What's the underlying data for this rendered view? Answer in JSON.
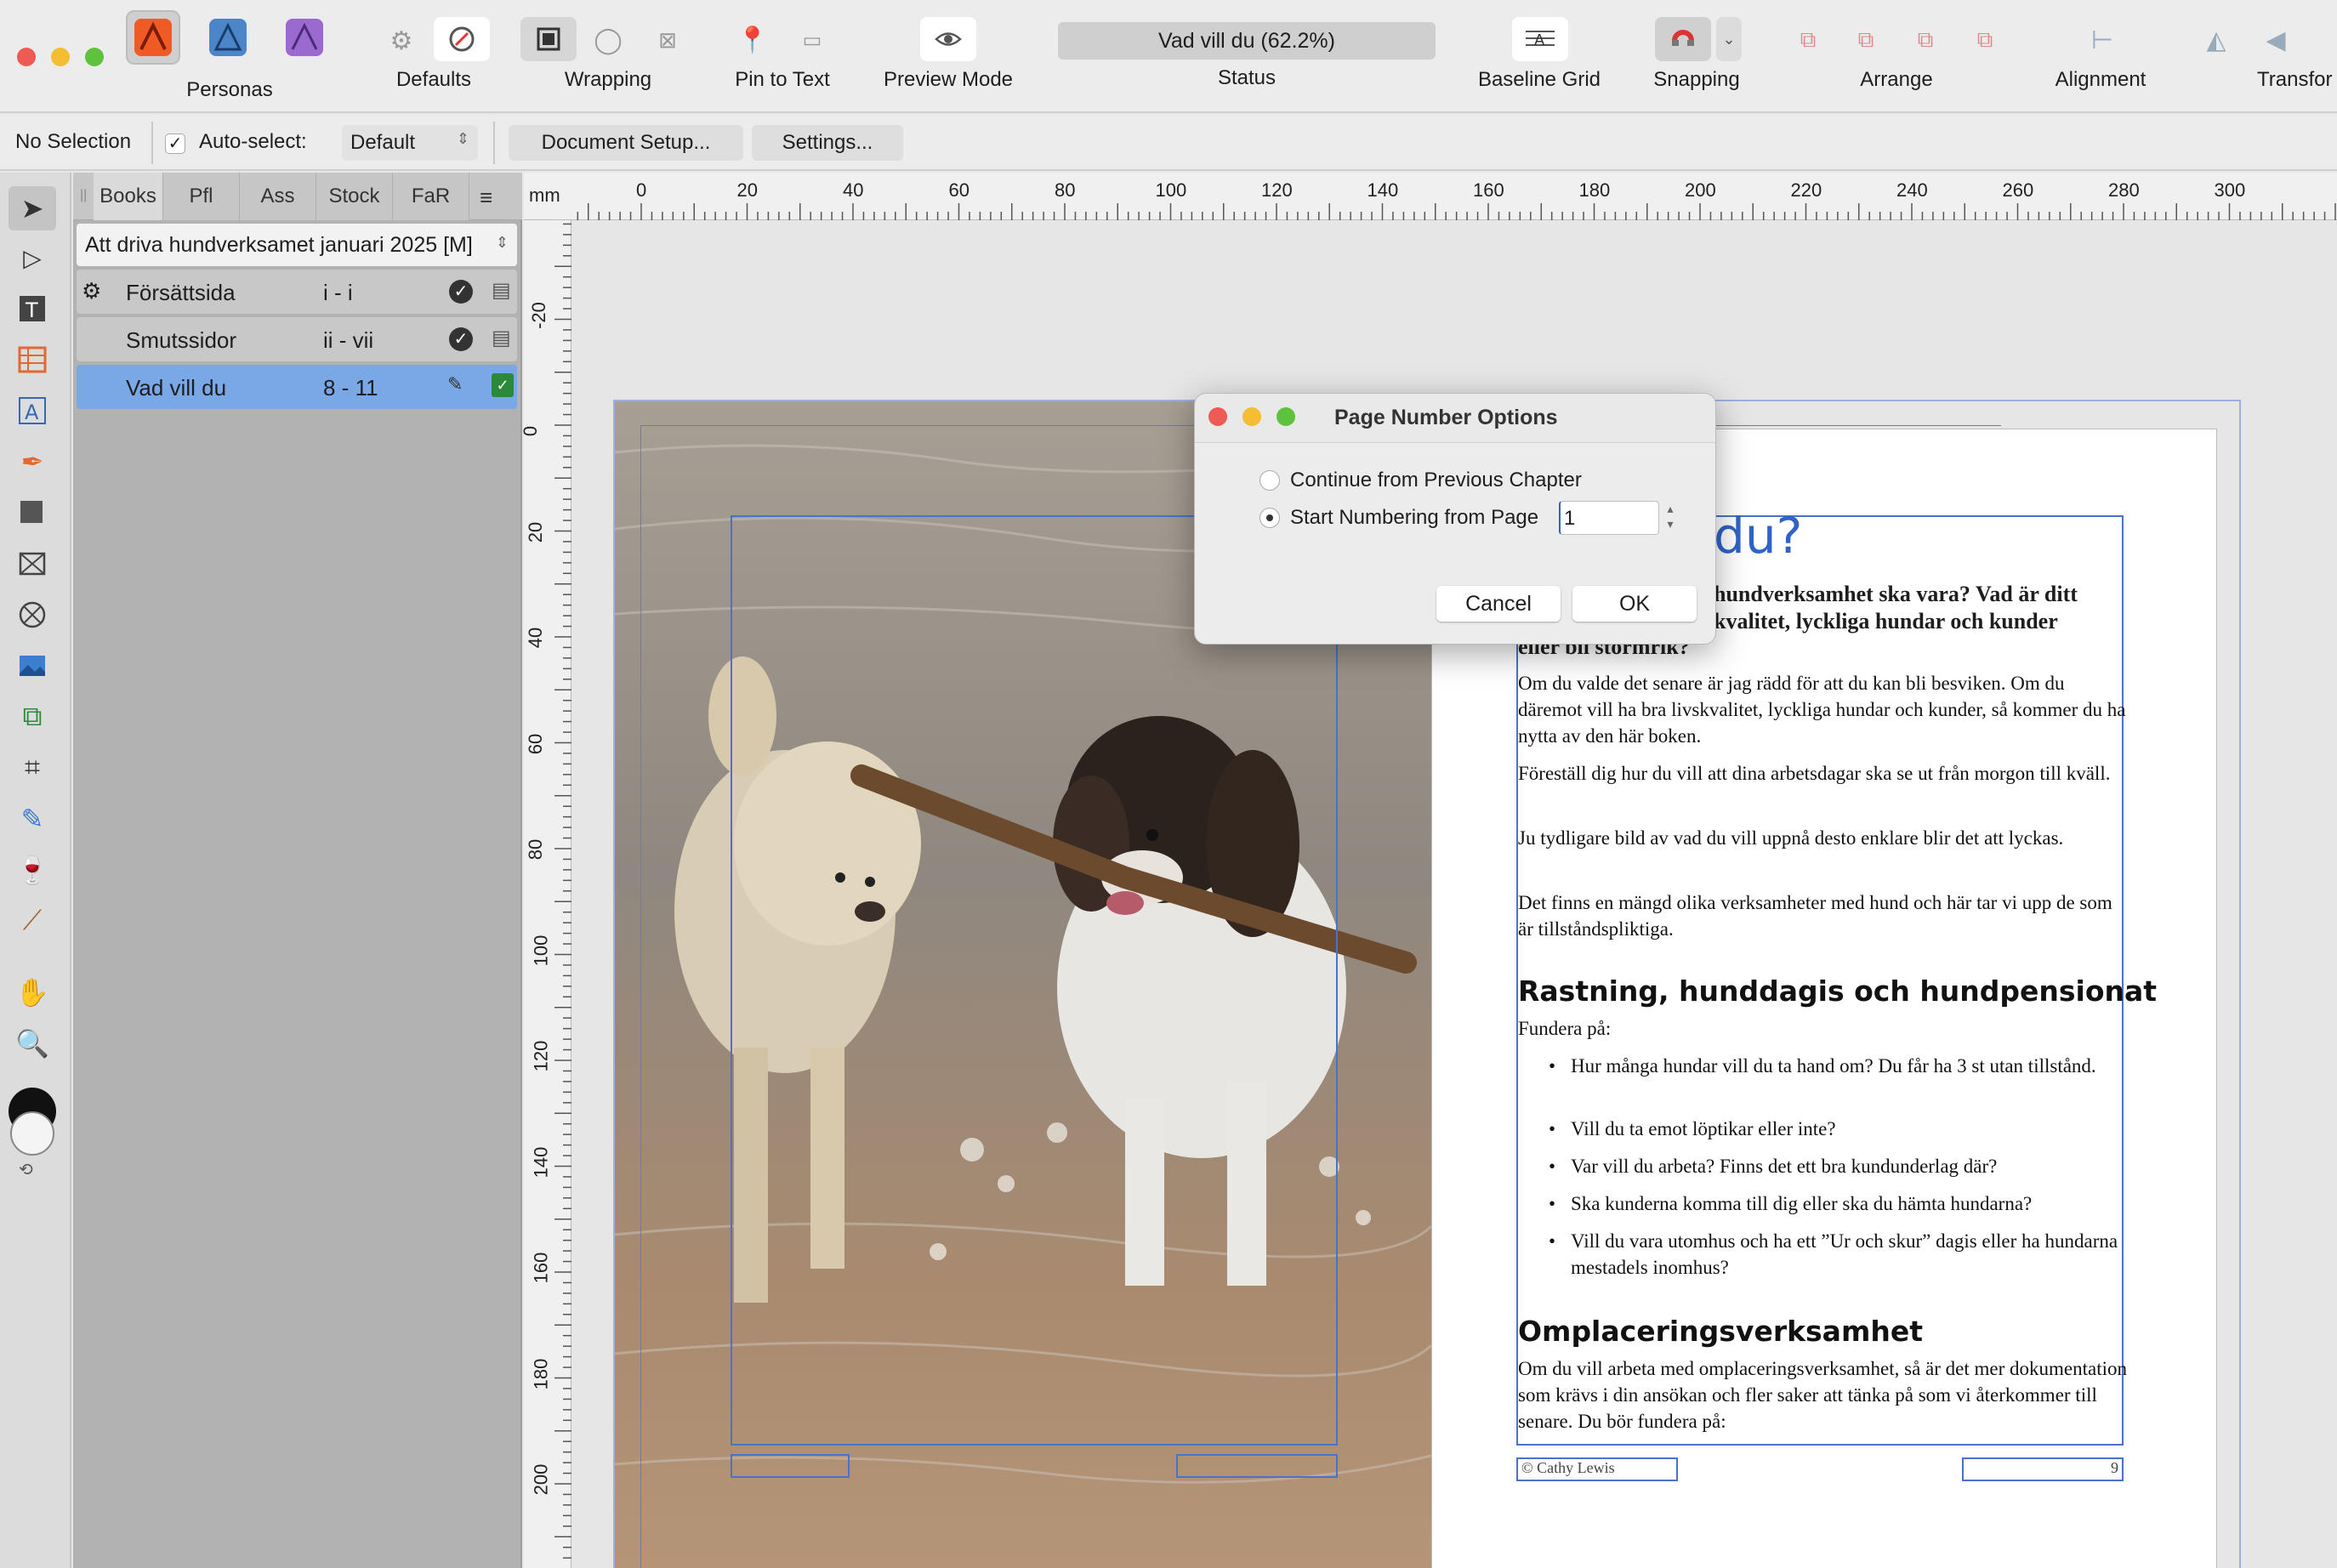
{
  "toolbar": {
    "personas_label": "Personas",
    "defaults_label": "Defaults",
    "wrapping_label": "Wrapping",
    "pin_label": "Pin to Text",
    "preview_label": "Preview Mode",
    "status_value": "Vad vill du (62.2%)",
    "status_label": "Status",
    "baseline_label": "Baseline Grid",
    "snapping_label": "Snapping",
    "arrange_label": "Arrange",
    "alignment_label": "Alignment",
    "transform_label": "Transfor"
  },
  "context": {
    "selection": "No Selection",
    "autoselect_label": "Auto-select:",
    "autoselect_value": "Default",
    "document_setup": "Document Setup...",
    "settings": "Settings..."
  },
  "panel": {
    "tabs": [
      "Books",
      "Pfl",
      "Ass",
      "Stock",
      "FaR"
    ],
    "book_name": "Att driva hundverksamet januari 2025 [M]",
    "chapters": [
      {
        "name": "Försättsida",
        "pages": "i - i"
      },
      {
        "name": "Smutssidor",
        "pages": "ii - vii"
      },
      {
        "name": "Vad vill du",
        "pages": "8 - 11"
      }
    ]
  },
  "ruler": {
    "unit": "mm",
    "top_ticks": [
      "0",
      "20",
      "40",
      "60",
      "80",
      "100",
      "120",
      "140",
      "160",
      "180",
      "200",
      "220",
      "240",
      "260",
      "280",
      "300"
    ],
    "left_ticks": [
      "-20",
      "0",
      "20",
      "40",
      "60",
      "80",
      "100",
      "120",
      "140",
      "160",
      "180",
      "200"
    ]
  },
  "dialog": {
    "title": "Page Number Options",
    "option1": "Continue from Previous Chapter",
    "option2": "Start Numbering from Page",
    "start_value": "1",
    "cancel": "Cancel",
    "ok": "OK"
  },
  "page": {
    "title_fragment": "du?",
    "intro_line1": "hundverksamhet ska vara? Vad är ditt",
    "intro_line2": "kvalitet, lyckliga hundar och kunder",
    "intro_line3": "eller bli stormrik?",
    "p1": "Om du valde det senare är jag rädd för att du kan bli besviken. Om du däremot vill ha bra livskvalitet, lyckliga hundar och kunder, så kommer du ha nytta av den här boken.",
    "p2": "Föreställ dig hur du vill att dina arbetsdagar ska se ut från morgon till kväll.",
    "p3": "Ju tydligare bild av vad du vill uppnå desto enklare blir det att lyckas.",
    "p4": "Det finns en mängd olika verksamheter med hund och här tar vi upp de som är tillståndspliktiga.",
    "h1": "Rastning, hunddagis och hundpensionat",
    "fundera": "Fundera på:",
    "bullets": [
      "Hur många hundar vill du ta hand om? Du får ha 3 st utan tillstånd.",
      "Vill du ta emot löptikar eller inte?",
      "Var vill du arbeta? Finns det ett bra kundunderlag där?",
      "Ska kunderna komma till dig eller ska du hämta hundarna?",
      "Vill du vara utomhus och ha ett ”Ur och skur” dagis eller ha hundarna mestadels inomhus?"
    ],
    "h2": "Omplaceringsverksamhet",
    "p5": "Om du vill arbeta med omplaceringsverksamhet, så är det mer dokumentation som krävs i din ansökan och fler saker att tänka på som vi återkommer till senare. Du bör fundera på:",
    "footer_left": "© Cathy Lewis",
    "footer_right": "9"
  },
  "colors": {
    "accent": "#2f63c8",
    "selection": "#7aa7e6",
    "frame": "#4a72c8"
  }
}
